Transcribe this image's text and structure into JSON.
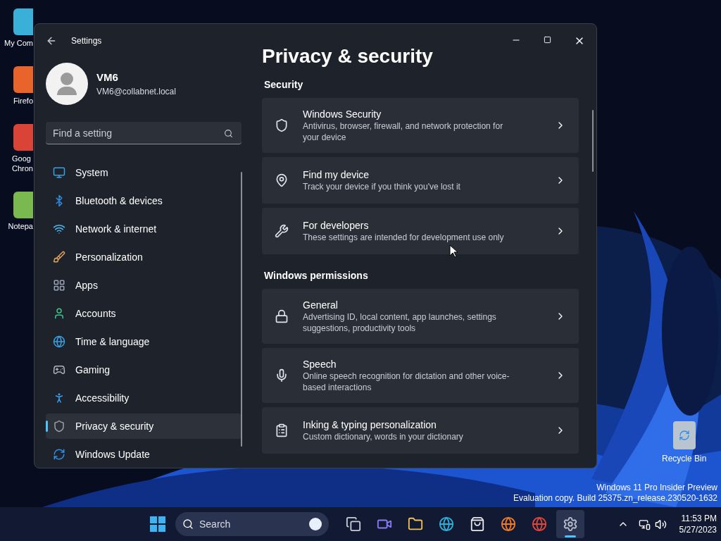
{
  "desktop_icons": [
    {
      "label": "My Com"
    },
    {
      "label": "Firefo"
    },
    {
      "label": "Goog\nChron"
    },
    {
      "label": "Notepa"
    },
    {
      "label": "Recycle Bin"
    }
  ],
  "window": {
    "title": "Settings",
    "user": {
      "name": "VM6",
      "email": "VM6@collabnet.local"
    },
    "search": {
      "placeholder": "Find a setting"
    },
    "nav": [
      {
        "label": "System",
        "selected": false
      },
      {
        "label": "Bluetooth & devices",
        "selected": false
      },
      {
        "label": "Network & internet",
        "selected": false
      },
      {
        "label": "Personalization",
        "selected": false
      },
      {
        "label": "Apps",
        "selected": false
      },
      {
        "label": "Accounts",
        "selected": false
      },
      {
        "label": "Time & language",
        "selected": false
      },
      {
        "label": "Gaming",
        "selected": false
      },
      {
        "label": "Accessibility",
        "selected": false
      },
      {
        "label": "Privacy & security",
        "selected": true
      },
      {
        "label": "Windows Update",
        "selected": false
      }
    ],
    "page_title": "Privacy & security",
    "sections": [
      {
        "title": "Security",
        "items": [
          {
            "title": "Windows Security",
            "description": "Antivirus, browser, firewall, and network protection for your device"
          },
          {
            "title": "Find my device",
            "description": "Track your device if you think you've lost it"
          },
          {
            "title": "For developers",
            "description": "These settings are intended for development use only"
          }
        ]
      },
      {
        "title": "Windows permissions",
        "items": [
          {
            "title": "General",
            "description": "Advertising ID, local content, app launches, settings suggestions, productivity tools"
          },
          {
            "title": "Speech",
            "description": "Online speech recognition for dictation and other voice-based interactions"
          },
          {
            "title": "Inking & typing personalization",
            "description": "Custom dictionary, words in your dictionary"
          }
        ]
      }
    ]
  },
  "os_notice": [
    "Windows 11 Pro Insider Preview",
    "Evaluation copy. Build 25375.zn_release.230520-1632"
  ],
  "taskbar": {
    "search_placeholder": "Search",
    "apps": [
      {
        "selected": false
      },
      {
        "selected": false
      },
      {
        "selected": false
      },
      {
        "selected": false
      },
      {
        "selected": false
      },
      {
        "selected": false
      },
      {
        "selected": false
      },
      {
        "selected": true
      }
    ],
    "time": "11:53 PM",
    "date": "5/27/2023"
  }
}
